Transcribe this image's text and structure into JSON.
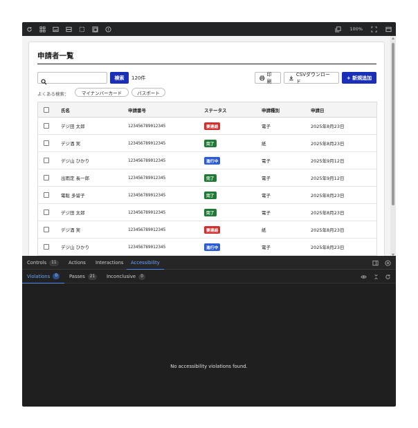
{
  "toolbar": {
    "left_icons": [
      "refresh-icon",
      "grid-icon",
      "image-icon",
      "panel-icon",
      "frame-icon",
      "outline-icon",
      "ruler-icon"
    ],
    "zoom": "100%",
    "right_icons": [
      "copy-icon",
      "fullscreen-icon",
      "sidebar-icon"
    ]
  },
  "page": {
    "title": "申請者一覧",
    "search_placeholder": "",
    "search_button": "検索",
    "result_count": "120件",
    "print_button": "印刷",
    "csv_button": "CSVダウンロード",
    "new_button": "+ 新規追加",
    "frequent_label": "よくある検索：",
    "frequent_chips": [
      "マイナンバーカード",
      "パスポート"
    ]
  },
  "table": {
    "headers": {
      "name": "氏名",
      "number": "申請番号",
      "status": "ステータス",
      "type": "申請種別",
      "date": "申請日"
    },
    "rows": [
      {
        "name": "デジ田 太郎",
        "number": "123456789012345",
        "status": "要連絡",
        "type": "電子",
        "date": "2025年8月23日"
      },
      {
        "name": "デジ酒 実",
        "number": "123456789012345",
        "status": "完了",
        "type": "紙",
        "date": "2025年8月23日"
      },
      {
        "name": "デジ山 ひかり",
        "number": "123456789012345",
        "status": "進行中",
        "type": "電子",
        "date": "2025年9月12日"
      },
      {
        "name": "出雨定 長一郎",
        "number": "123456789012345",
        "status": "完了",
        "type": "電子",
        "date": "2025年9月12日"
      },
      {
        "name": "電聡 多留子",
        "number": "123456789012345",
        "status": "完了",
        "type": "電子",
        "date": "2025年8月23日"
      },
      {
        "name": "デジ田 太郎",
        "number": "123456789012345",
        "status": "完了",
        "type": "電子",
        "date": "2025年8月23日"
      },
      {
        "name": "デジ酒 実",
        "number": "123456789012345",
        "status": "要連絡",
        "type": "紙",
        "date": "2025年8月23日"
      },
      {
        "name": "デジ山 ひかり",
        "number": "123456789012345",
        "status": "進行中",
        "type": "電子",
        "date": "2025年8月23日"
      }
    ]
  },
  "status_colors": {
    "要連絡": "#d32f2f",
    "完了": "#1e7a34",
    "進行中": "#2b5bd7"
  },
  "devtools": {
    "tabs": [
      {
        "label": "Controls",
        "count": "11"
      },
      {
        "label": "Actions"
      },
      {
        "label": "Interactions"
      },
      {
        "label": "Accessibility"
      }
    ],
    "subtabs": [
      {
        "label": "Violations",
        "count": "0"
      },
      {
        "label": "Passes",
        "count": "21"
      },
      {
        "label": "Inconclusive",
        "count": "0"
      }
    ],
    "empty_message": "No accessibility violations found."
  },
  "colors": {
    "accent": "#1a2fb8",
    "devtools_active": "#6aa7ff",
    "devtools_bg": "#1f1f20"
  }
}
